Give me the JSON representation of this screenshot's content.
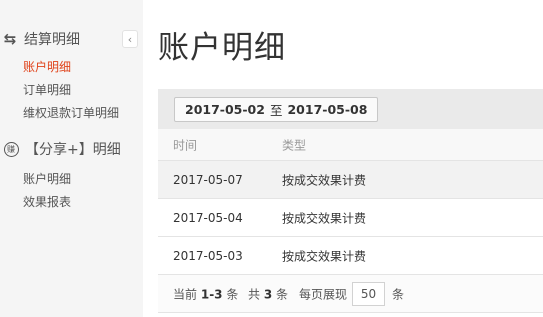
{
  "sidebar": {
    "collapse_icon": "‹",
    "groups": [
      {
        "icon": "swap-icon",
        "title": "结算明细",
        "items": [
          {
            "label": "账户明细",
            "active": true
          },
          {
            "label": "订单明细"
          },
          {
            "label": "维权退款订单明细"
          }
        ]
      },
      {
        "icon": "share-icon",
        "icon_text": "赚",
        "title": "【分享+】明细",
        "items": [
          {
            "label": "账户明细"
          },
          {
            "label": "效果报表"
          }
        ]
      }
    ]
  },
  "page": {
    "title": "账户明细"
  },
  "filter": {
    "date_start": "2017-05-02",
    "separator": "至",
    "date_end": "2017-05-08"
  },
  "table": {
    "headers": [
      "时间",
      "类型"
    ],
    "rows": [
      {
        "date": "2017-05-07",
        "type": "按成交效果计费"
      },
      {
        "date": "2017-05-04",
        "type": "按成交效果计费"
      },
      {
        "date": "2017-05-03",
        "type": "按成交效果计费"
      }
    ]
  },
  "pager": {
    "current_prefix": "当前",
    "current_range": "1-3",
    "current_suffix": "条",
    "total_prefix": "共",
    "total_count": "3",
    "total_suffix": "条",
    "per_page_label": "每页展现",
    "per_page_value": "50",
    "per_page_suffix": "条"
  },
  "colors": {
    "active": "#e0431b",
    "sidebar_bg": "#f5f5f5",
    "filter_bg": "#eaeaea"
  }
}
